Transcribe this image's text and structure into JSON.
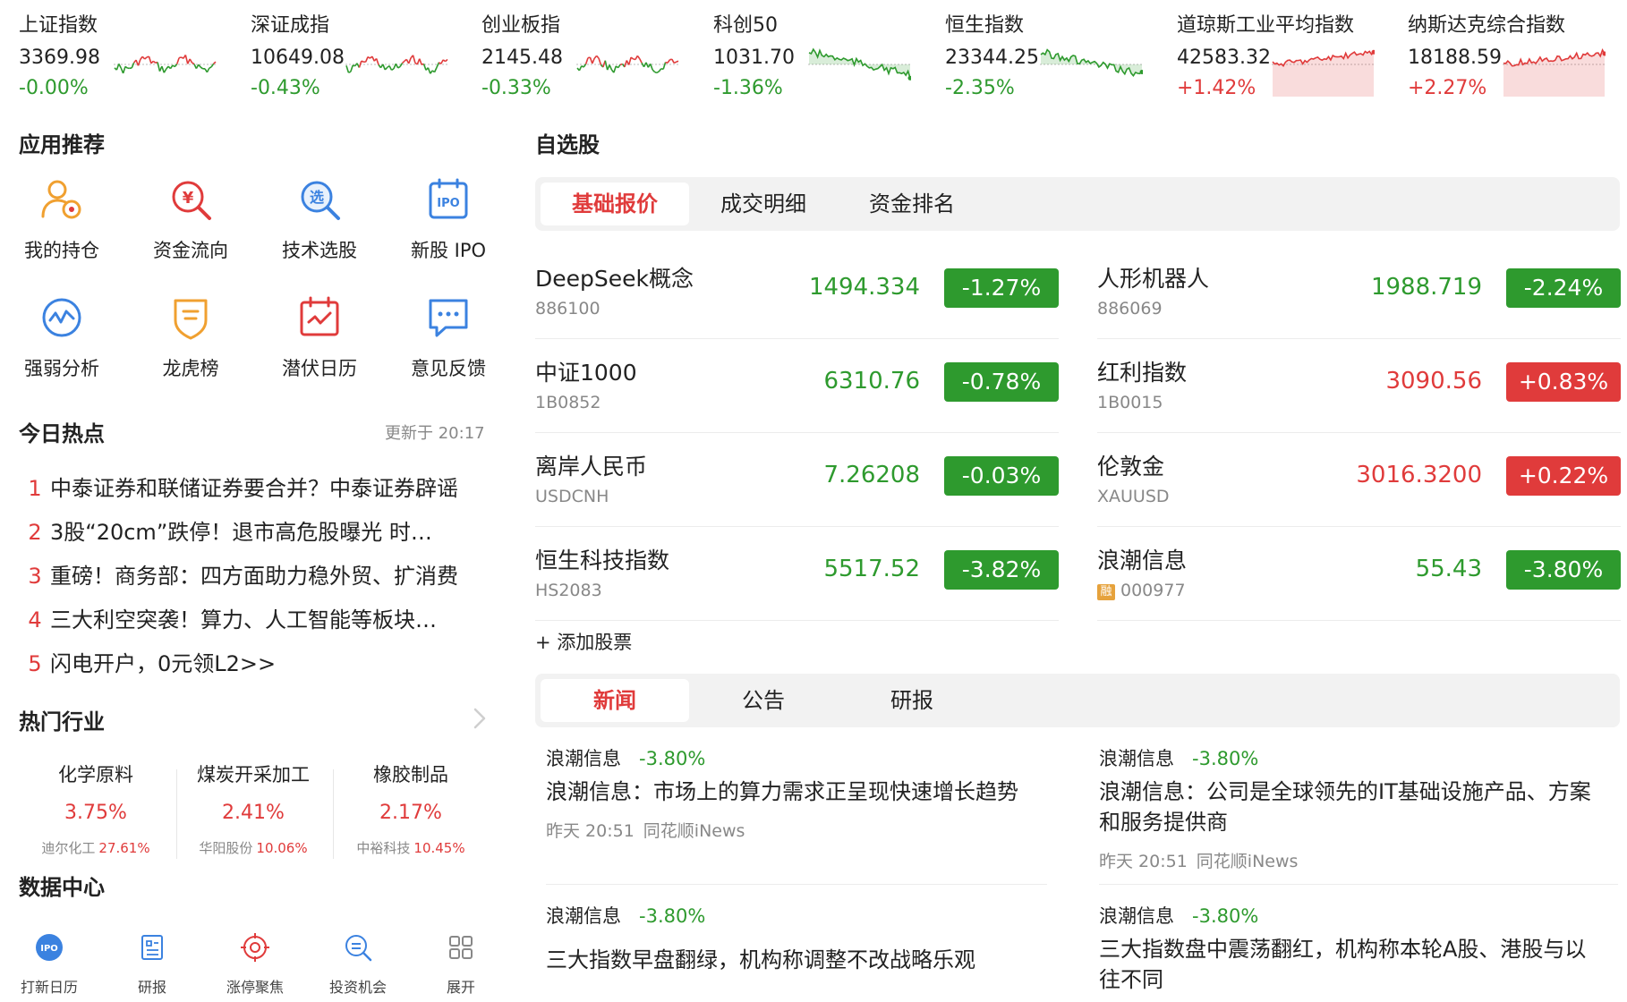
{
  "indices": [
    {
      "name": "上证指数",
      "value": "3369.98",
      "change": "-0.00%",
      "dir": "down",
      "spark": "mixed"
    },
    {
      "name": "深证成指",
      "value": "10649.08",
      "change": "-0.43%",
      "dir": "down",
      "spark": "mixed"
    },
    {
      "name": "创业板指",
      "value": "2145.48",
      "change": "-0.33%",
      "dir": "down",
      "spark": "mixed"
    },
    {
      "name": "科创50",
      "value": "1031.70",
      "change": "-1.36%",
      "dir": "down",
      "spark": "down"
    },
    {
      "name": "恒生指数",
      "value": "23344.25",
      "change": "-2.35%",
      "dir": "down",
      "spark": "down"
    },
    {
      "name": "道琼斯工业平均指数",
      "value": "42583.32",
      "change": "+1.42%",
      "dir": "up",
      "spark": "up"
    },
    {
      "name": "纳斯达克综合指数",
      "value": "18188.59",
      "change": "+2.27%",
      "dir": "up",
      "spark": "up"
    }
  ],
  "apps": {
    "title": "应用推荐",
    "items": [
      {
        "label": "我的持仓",
        "icon": "user-holding-icon"
      },
      {
        "label": "资金流向",
        "icon": "yuan-search-icon"
      },
      {
        "label": "技术选股",
        "icon": "stock-pick-search-icon"
      },
      {
        "label": "新股 IPO",
        "icon": "ipo-icon"
      },
      {
        "label": "强弱分析",
        "icon": "wave-analysis-icon"
      },
      {
        "label": "龙虎榜",
        "icon": "shield-badge-icon"
      },
      {
        "label": "潜伏日历",
        "icon": "calendar-check-icon"
      },
      {
        "label": "意见反馈",
        "icon": "feedback-chat-icon"
      }
    ]
  },
  "hot_news": {
    "title": "今日热点",
    "updated": "更新于 20:17",
    "items": [
      {
        "rank": "1",
        "text": "中泰证券和联储证券要合并？中泰证券辟谣"
      },
      {
        "rank": "2",
        "text": "3股“20cm”跌停！退市高危股曝光 时…"
      },
      {
        "rank": "3",
        "text": "重磅！商务部：四方面助力稳外贸、扩消费"
      },
      {
        "rank": "4",
        "text": "三大利空突袭！算力、人工智能等板块…"
      },
      {
        "rank": "5",
        "text": "闪电开户，0元领L2>>"
      }
    ]
  },
  "industries": {
    "title": "热门行业",
    "items": [
      {
        "name": "化学原料",
        "pct": "3.75%",
        "leader": "迪尔化工",
        "leader_pct": "27.61%"
      },
      {
        "name": "煤炭开采加工",
        "pct": "2.41%",
        "leader": "华阳股份",
        "leader_pct": "10.06%"
      },
      {
        "name": "橡胶制品",
        "pct": "2.17%",
        "leader": "中裕科技",
        "leader_pct": "10.45%"
      }
    ]
  },
  "data_center": {
    "title": "数据中心",
    "items": [
      {
        "label": "打新日历",
        "icon": "ipo-calendar-icon"
      },
      {
        "label": "研报",
        "icon": "research-report-icon"
      },
      {
        "label": "涨停聚焦",
        "icon": "target-icon"
      },
      {
        "label": "投资机会",
        "icon": "opportunity-search-icon"
      },
      {
        "label": "展开",
        "icon": "grid-expand-icon"
      }
    ]
  },
  "watchlist": {
    "title": "自选股",
    "tabs": [
      "基础报价",
      "成交明细",
      "资金排名"
    ],
    "active_tab": "基础报价",
    "stocks": [
      {
        "name": "DeepSeek概念",
        "code": "886100",
        "price": "1494.334",
        "change": "-1.27%",
        "dir": "down"
      },
      {
        "name": "人形机器人",
        "code": "886069",
        "price": "1988.719",
        "change": "-2.24%",
        "dir": "down"
      },
      {
        "name": "中证1000",
        "code": "1B0852",
        "price": "6310.76",
        "change": "-0.78%",
        "dir": "down"
      },
      {
        "name": "红利指数",
        "code": "1B0015",
        "price": "3090.56",
        "change": "+0.83%",
        "dir": "up"
      },
      {
        "name": "离岸人民币",
        "code": "USDCNH",
        "price": "7.26208",
        "change": "-0.03%",
        "dir": "down"
      },
      {
        "name": "伦敦金",
        "code": "XAUUSD",
        "price": "3016.3200",
        "change": "+0.22%",
        "dir": "up"
      },
      {
        "name": "恒生科技指数",
        "code": "HS2083",
        "price": "5517.52",
        "change": "-3.82%",
        "dir": "down"
      },
      {
        "name": "浪潮信息",
        "code": "000977",
        "price": "55.43",
        "change": "-3.80%",
        "dir": "down",
        "tag": "融"
      }
    ],
    "add_label": "+ 添加股票"
  },
  "news_panel": {
    "tabs": [
      "新闻",
      "公告",
      "研报"
    ],
    "active_tab": "新闻",
    "items": [
      {
        "stock": "浪潮信息",
        "change": "-3.80%",
        "title": "浪潮信息：市场上的算力需求正呈现快速增长趋势",
        "time": "昨天 20:51",
        "source": "同花顺iNews"
      },
      {
        "stock": "浪潮信息",
        "change": "-3.80%",
        "title": "浪潮信息：公司是全球领先的IT基础设施产品、方案和服务提供商",
        "time": "昨天 20:51",
        "source": "同花顺iNews"
      },
      {
        "stock": "浪潮信息",
        "change": "-3.80%",
        "title": "三大指数早盘翻绿，机构称调整不改战略乐观"
      },
      {
        "stock": "浪潮信息",
        "change": "-3.80%",
        "title": "三大指数盘中震荡翻红，机构称本轮A股、港股与以往不同"
      }
    ]
  },
  "colors": {
    "up": "#e03b3b",
    "down": "#2e9a2e",
    "accent": "#e03b3b",
    "icon_blue": "#3b82e0",
    "icon_orange": "#f0a030"
  }
}
